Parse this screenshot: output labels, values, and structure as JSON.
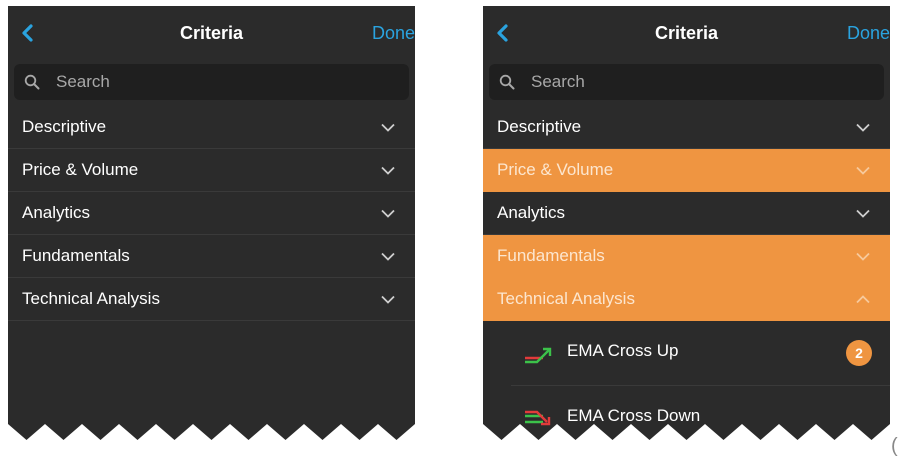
{
  "screens": [
    {
      "navbar": {
        "back_icon": "chevron-left-icon",
        "title": "Criteria",
        "done_label": "Done"
      },
      "search": {
        "placeholder": "Search",
        "value": ""
      },
      "rows": [
        {
          "label": "Descriptive",
          "highlighted": false,
          "expanded": false
        },
        {
          "label": "Price & Volume",
          "highlighted": false,
          "expanded": false
        },
        {
          "label": "Analytics",
          "highlighted": false,
          "expanded": false
        },
        {
          "label": "Fundamentals",
          "highlighted": false,
          "expanded": false
        },
        {
          "label": "Technical Analysis",
          "highlighted": false,
          "expanded": false
        }
      ]
    },
    {
      "navbar": {
        "back_icon": "chevron-left-icon",
        "title": "Criteria",
        "done_label": "Done"
      },
      "search": {
        "placeholder": "Search",
        "value": ""
      },
      "rows": [
        {
          "label": "Descriptive",
          "highlighted": false,
          "expanded": false
        },
        {
          "label": "Price & Volume",
          "highlighted": true,
          "expanded": false
        },
        {
          "label": "Analytics",
          "highlighted": false,
          "expanded": false
        },
        {
          "label": "Fundamentals",
          "highlighted": true,
          "expanded": false
        },
        {
          "label": "Technical Analysis",
          "highlighted": true,
          "expanded": true
        }
      ],
      "sub_items": [
        {
          "label": "EMA Cross Up",
          "icon": "ema-cross-up-icon",
          "badge": "2"
        },
        {
          "label": "EMA Cross Down",
          "icon": "ema-cross-down-icon",
          "badge": ""
        }
      ]
    }
  ],
  "page_number": "(",
  "colors": {
    "panel_bg": "#2b2b2b",
    "accent_orange": "#ef9541",
    "link_blue": "#2aa3df",
    "divider": "#3a3a3a"
  }
}
